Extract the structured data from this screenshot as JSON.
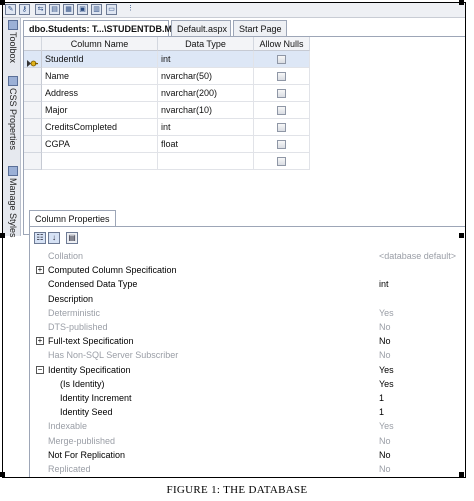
{
  "tabs": [
    {
      "label": "dbo.Students: T...\\STUDENTDB.MDF)",
      "active": true
    },
    {
      "label": "Default.aspx",
      "active": false
    },
    {
      "label": "Start Page",
      "active": false
    }
  ],
  "sidebar": {
    "items": [
      "Toolbox",
      "CSS Properties",
      "Manage Styles"
    ]
  },
  "grid": {
    "headers": [
      "Column Name",
      "Data Type",
      "Allow Nulls"
    ],
    "rows": [
      {
        "name": "StudentId",
        "type": "int",
        "allow_nulls": false,
        "primary_key": true
      },
      {
        "name": "Name",
        "type": "nvarchar(50)",
        "allow_nulls": false
      },
      {
        "name": "Address",
        "type": "nvarchar(200)",
        "allow_nulls": false
      },
      {
        "name": "Major",
        "type": "nvarchar(10)",
        "allow_nulls": false
      },
      {
        "name": "CreditsCompleted",
        "type": "int",
        "allow_nulls": false
      },
      {
        "name": "CGPA",
        "type": "float",
        "allow_nulls": false
      },
      {
        "name": "",
        "type": "",
        "allow_nulls": false
      }
    ]
  },
  "column_properties": {
    "tab_label": "Column Properties",
    "properties": [
      {
        "name": "Collation",
        "value": "<database default>",
        "state": "dim",
        "expander": ""
      },
      {
        "name": "Computed Column Specification",
        "value": "",
        "state": "active",
        "expander": "+"
      },
      {
        "name": "Condensed Data Type",
        "value": "int",
        "state": "active",
        "expander": ""
      },
      {
        "name": "Description",
        "value": "",
        "state": "active",
        "expander": ""
      },
      {
        "name": "Deterministic",
        "value": "Yes",
        "state": "dim",
        "expander": ""
      },
      {
        "name": "DTS-published",
        "value": "No",
        "state": "dim",
        "expander": ""
      },
      {
        "name": "Full-text Specification",
        "value": "No",
        "state": "active",
        "expander": "+"
      },
      {
        "name": "Has Non-SQL Server Subscriber",
        "value": "No",
        "state": "dim",
        "expander": ""
      },
      {
        "name": "Identity Specification",
        "value": "Yes",
        "state": "active",
        "expander": "−"
      },
      {
        "name": "(Is Identity)",
        "value": "Yes",
        "state": "active",
        "expander": "",
        "sub": true
      },
      {
        "name": "Identity Increment",
        "value": "1",
        "state": "active",
        "expander": "",
        "sub": true
      },
      {
        "name": "Identity Seed",
        "value": "1",
        "state": "active",
        "expander": "",
        "sub": true
      },
      {
        "name": "Indexable",
        "value": "Yes",
        "state": "dim",
        "expander": ""
      },
      {
        "name": "Merge-published",
        "value": "No",
        "state": "dim",
        "expander": ""
      },
      {
        "name": "Not For Replication",
        "value": "No",
        "state": "active",
        "expander": ""
      },
      {
        "name": "Replicated",
        "value": "No",
        "state": "dim",
        "expander": ""
      }
    ]
  },
  "caption": "FIGURE 1: THE DATABASE"
}
